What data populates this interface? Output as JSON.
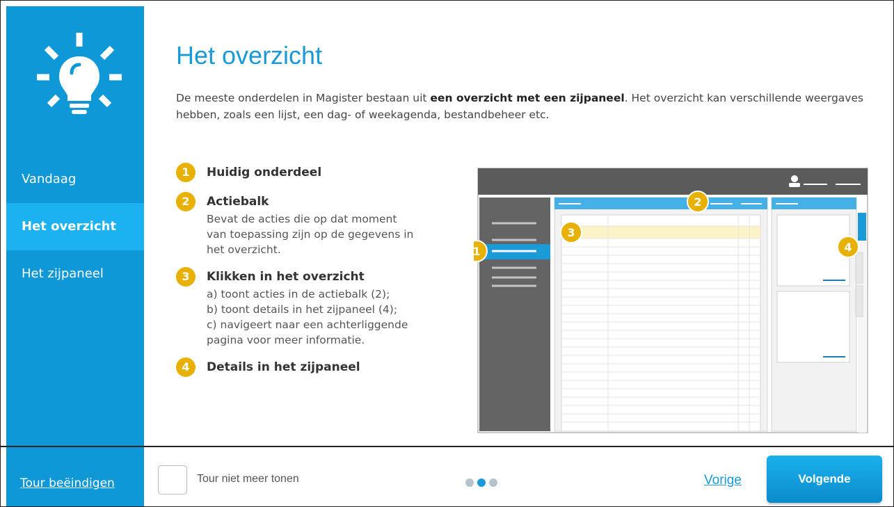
{
  "sidebar": {
    "items": [
      {
        "label": "Vandaag"
      },
      {
        "label": "Het overzicht",
        "active": true
      },
      {
        "label": "Het zijpaneel"
      }
    ]
  },
  "main": {
    "title": "Het overzicht",
    "intro": {
      "before": "De meeste onderdelen in Magister bestaan uit ",
      "bold": "een overzicht met een zijpaneel",
      "after": ". Het overzicht kan verschillende weergaves hebben, zoals een lijst, een dag- of weekagenda, bestandbeheer etc."
    },
    "steps": [
      {
        "number": "1",
        "title": "Huidig onderdeel",
        "desc": ""
      },
      {
        "number": "2",
        "title": "Actiebalk",
        "desc": "Bevat de acties die op dat moment\nvan toepassing zijn op de gegevens in\nhet overzicht."
      },
      {
        "number": "3",
        "title": "Klikken in het overzicht",
        "desc": "a) toont acties in de actiebalk (2);\nb) toont details in het zijpaneel (4);\nc) navigeert naar een achterliggende\npagina voor meer informatie."
      },
      {
        "number": "4",
        "title": "Details in het zijpaneel",
        "desc": ""
      }
    ],
    "illustration_badges": [
      "1",
      "2",
      "3",
      "4"
    ]
  },
  "footer": {
    "end_tour_label": "Tour beëindigen",
    "dont_show_label": "Tour niet meer tonen",
    "pager": {
      "current": 2,
      "total": 3
    },
    "prev_label": "Vorige",
    "next_label": "Volgende"
  },
  "colors": {
    "brand_blue": "#0e98d8",
    "active_blue": "#1cb1f0",
    "badge_gold": "#e8b100"
  }
}
